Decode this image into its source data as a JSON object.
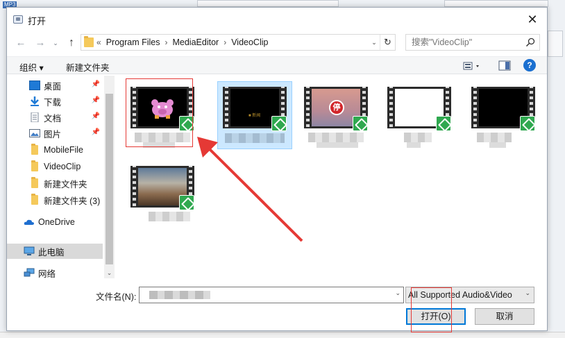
{
  "background": {
    "badge": "MP3"
  },
  "dialog": {
    "title": "打开",
    "close_label": "✕"
  },
  "nav": {
    "back": "←",
    "forward": "→",
    "history": "⌄",
    "up": "↑",
    "breadcrumb_overflow": "«",
    "breadcrumb": [
      "Program Files",
      "MediaEditor",
      "VideoClip"
    ],
    "separator": "›",
    "address_dropdown": "⌄",
    "refresh": "↻",
    "search_placeholder": "搜索\"VideoClip\""
  },
  "toolbar": {
    "organize": "组织 ▾",
    "new_folder": "新建文件夹",
    "view_icon": "view-icon",
    "preview_icon": "preview-pane-icon",
    "help": "?"
  },
  "sidebar": {
    "items": [
      {
        "label": "桌面",
        "icon": "desktop-icon",
        "pinned": true
      },
      {
        "label": "下载",
        "icon": "download-icon",
        "pinned": true
      },
      {
        "label": "文档",
        "icon": "document-icon",
        "pinned": true
      },
      {
        "label": "图片",
        "icon": "pictures-icon",
        "pinned": true
      },
      {
        "label": "MobileFile",
        "icon": "folder-icon",
        "pinned": false
      },
      {
        "label": "VideoClip",
        "icon": "folder-icon",
        "pinned": false
      },
      {
        "label": "新建文件夹",
        "icon": "folder-icon",
        "pinned": false
      },
      {
        "label": "新建文件夹 (3)",
        "icon": "folder-icon",
        "pinned": false
      },
      {
        "label": "OneDrive",
        "icon": "cloud-icon",
        "pinned": false
      },
      {
        "label": "此电脑",
        "icon": "computer-icon",
        "pinned": false,
        "selected": true
      },
      {
        "label": "网络",
        "icon": "network-icon",
        "pinned": false
      }
    ],
    "pin_glyph": "📌",
    "scroll_down": "⌄"
  },
  "files": {
    "thumb_labels": {
      "tile2": "■ 新闻",
      "tile3": "停"
    },
    "colors": {
      "badge": "#2fa84f",
      "selection": "#cce8ff",
      "annotation": "#e53935"
    }
  },
  "footer": {
    "filename_label": "文件名(N):",
    "filetype": "All Supported Audio&Video",
    "open": "打开(O)",
    "cancel": "取消"
  }
}
